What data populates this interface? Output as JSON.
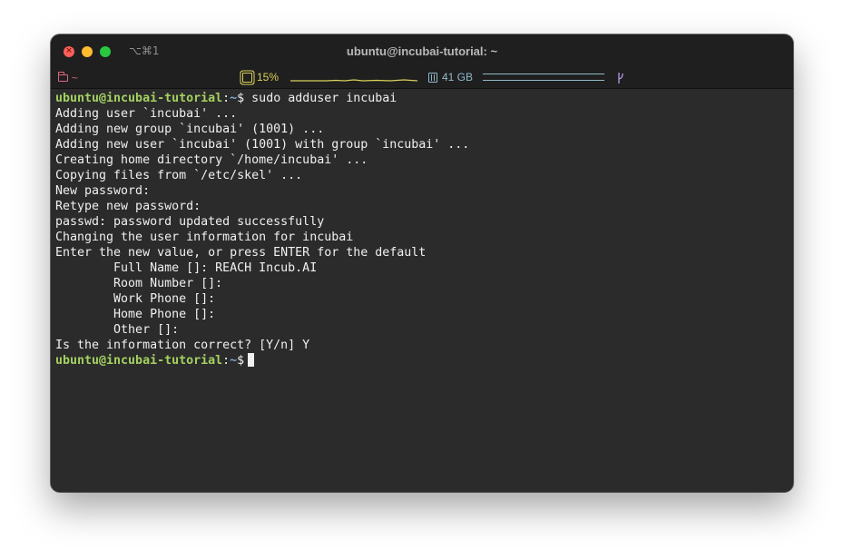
{
  "window": {
    "title": "ubuntu@incubai-tutorial: ~",
    "shortcut": "⌥⌘1"
  },
  "status": {
    "directory": "~",
    "cpu": "15%",
    "memory": "41 GB"
  },
  "prompt": {
    "user_host": "ubuntu@incubai-tutorial",
    "separator": ":",
    "path": "~",
    "symbol": "$"
  },
  "terminal": {
    "command": " sudo adduser incubai",
    "output": [
      "Adding user `incubai' ...",
      "Adding new group `incubai' (1001) ...",
      "Adding new user `incubai' (1001) with group `incubai' ...",
      "Creating home directory `/home/incubai' ...",
      "Copying files from `/etc/skel' ...",
      "New password:",
      "Retype new password:",
      "passwd: password updated successfully",
      "Changing the user information for incubai",
      "Enter the new value, or press ENTER for the default",
      "        Full Name []: REACH Incub.AI",
      "        Room Number []:",
      "        Work Phone []:",
      "        Home Phone []:",
      "        Other []:",
      "Is the information correct? [Y/n] Y"
    ]
  },
  "colors": {
    "prompt_user": "#a3d160",
    "prompt_path": "#7fa7d9",
    "cpu": "#d8cf5a",
    "memory": "#8fb9c8",
    "directory": "#d9677c"
  }
}
